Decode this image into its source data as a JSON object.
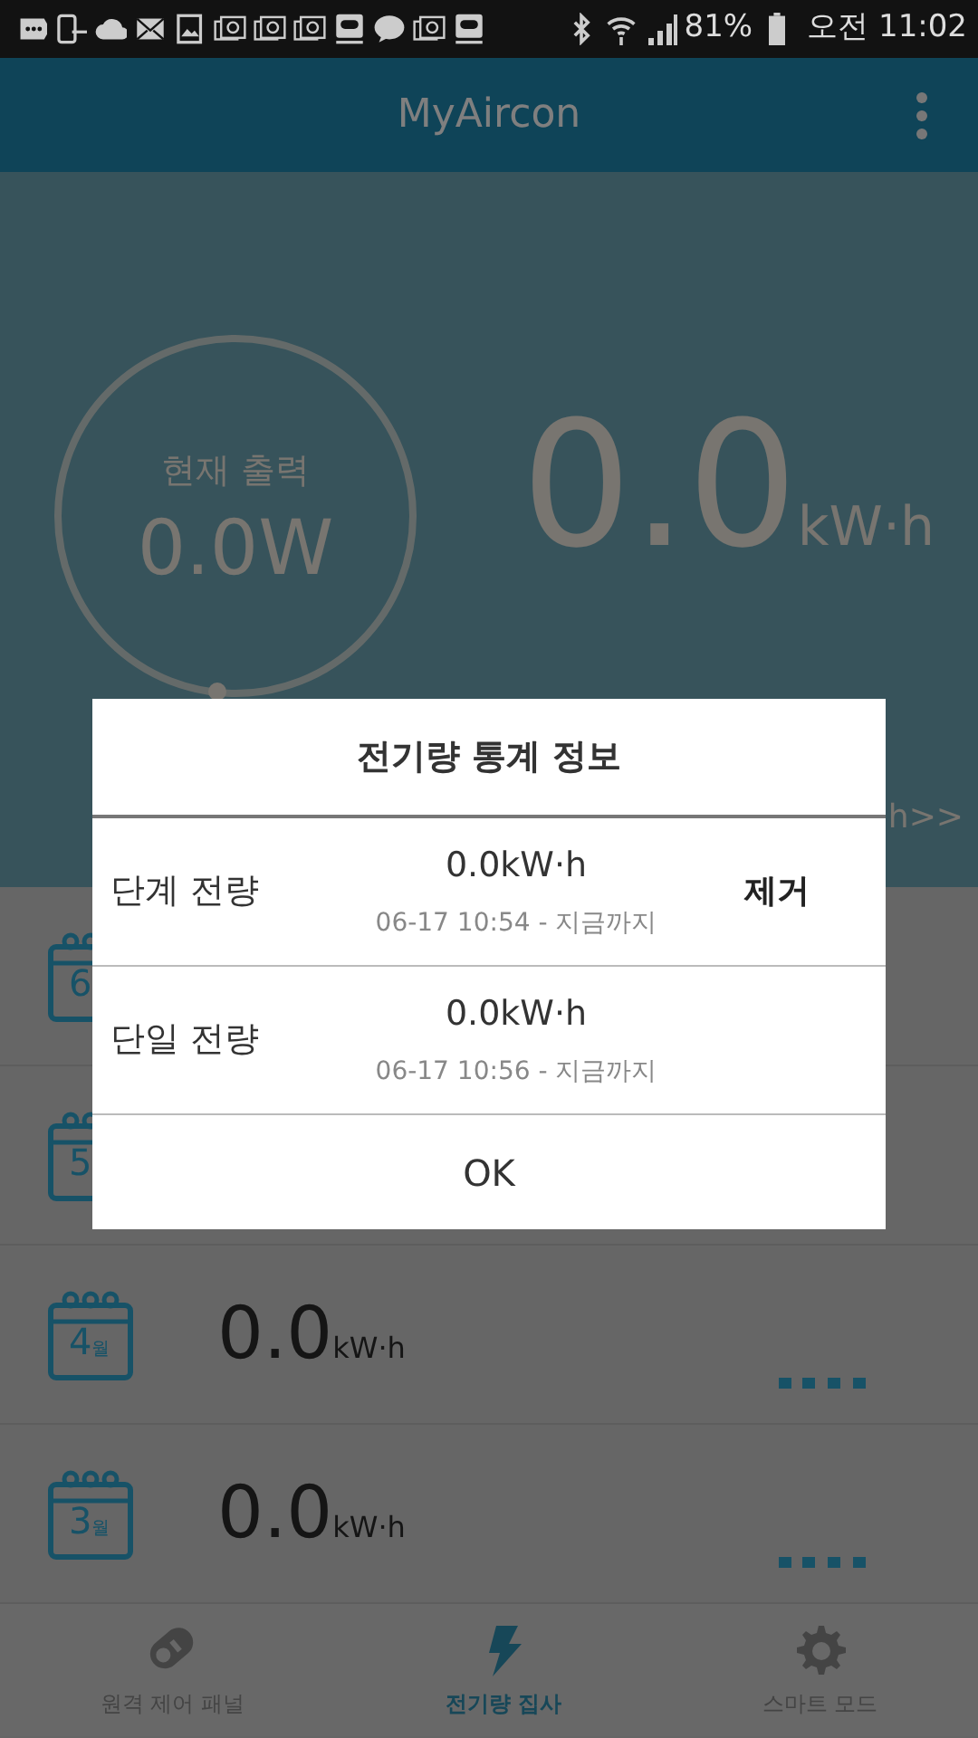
{
  "status_bar": {
    "notifications": [
      {
        "kind": "chat"
      },
      {
        "kind": "phone"
      },
      {
        "kind": "cloud"
      },
      {
        "kind": "mail"
      },
      {
        "kind": "image"
      },
      {
        "kind": "at"
      },
      {
        "kind": "at"
      },
      {
        "kind": "at"
      },
      {
        "kind": "band"
      },
      {
        "kind": "talk"
      },
      {
        "kind": "at"
      },
      {
        "kind": "band"
      }
    ],
    "battery": "81%",
    "time": "오전 11:02"
  },
  "app_bar": {
    "title": "MyAircon"
  },
  "hero": {
    "gauge_label": "현재 출력",
    "gauge_value": "0.0W",
    "total_value": "0.0",
    "total_unit": "kW·h",
    "link": "h>>"
  },
  "months": [
    {
      "month": "6"
    },
    {
      "month": "5"
    },
    {
      "month": "4",
      "unit": "월",
      "value": "0.0",
      "value_unit": "kW·h"
    },
    {
      "month": "3",
      "unit": "월",
      "value": "0.0",
      "value_unit": "kW·h"
    }
  ],
  "dialog": {
    "title": "전기량 통계 정보",
    "rows": [
      {
        "label": "단계 전량",
        "value": "0.0kW·h",
        "period": "06-17 10:54 - 지금까지",
        "action": "제거"
      },
      {
        "label": "단일 전량",
        "value": "0.0kW·h",
        "period": "06-17 10:56 - 지금까지"
      }
    ],
    "ok": "OK"
  },
  "nav": [
    {
      "kind": "remote",
      "label": "원격 제어 패널",
      "selected": false
    },
    {
      "kind": "bolt",
      "label": "전기량 집사",
      "selected": true
    },
    {
      "kind": "gear",
      "label": "스마트 모드",
      "selected": false
    }
  ]
}
